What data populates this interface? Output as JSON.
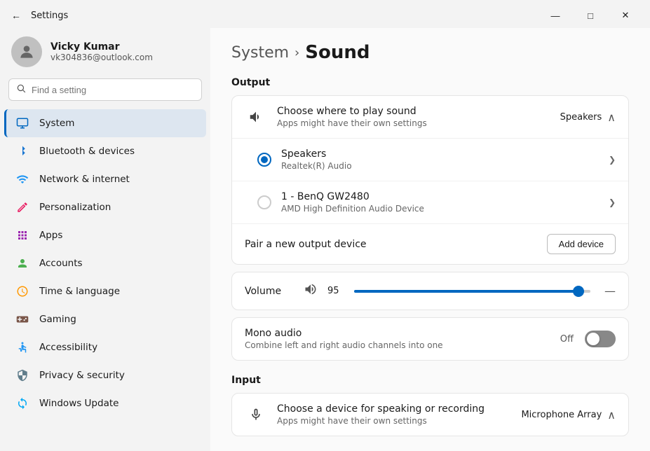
{
  "titlebar": {
    "back_icon": "←",
    "title": "Settings",
    "minimize": "—",
    "maximize": "□",
    "close": "✕"
  },
  "sidebar": {
    "user": {
      "name": "Vicky Kumar",
      "email": "vk304836@outlook.com"
    },
    "search_placeholder": "Find a setting",
    "nav_items": [
      {
        "id": "system",
        "label": "System",
        "icon": "💻",
        "active": true
      },
      {
        "id": "bluetooth",
        "label": "Bluetooth & devices",
        "icon": "🔵",
        "active": false
      },
      {
        "id": "network",
        "label": "Network & internet",
        "icon": "🌐",
        "active": false
      },
      {
        "id": "personalization",
        "label": "Personalization",
        "icon": "✏️",
        "active": false
      },
      {
        "id": "apps",
        "label": "Apps",
        "icon": "📦",
        "active": false
      },
      {
        "id": "accounts",
        "label": "Accounts",
        "icon": "👤",
        "active": false
      },
      {
        "id": "time",
        "label": "Time & language",
        "icon": "🌍",
        "active": false
      },
      {
        "id": "gaming",
        "label": "Gaming",
        "icon": "🎮",
        "active": false
      },
      {
        "id": "accessibility",
        "label": "Accessibility",
        "icon": "♿",
        "active": false
      },
      {
        "id": "privacy",
        "label": "Privacy & security",
        "icon": "🛡️",
        "active": false
      },
      {
        "id": "update",
        "label": "Windows Update",
        "icon": "🔄",
        "active": false
      }
    ]
  },
  "content": {
    "breadcrumb_parent": "System",
    "breadcrumb_separator": "›",
    "breadcrumb_current": "Sound",
    "output_section_label": "Output",
    "choose_where": {
      "title": "Choose where to play sound",
      "subtitle": "Apps might have their own settings",
      "current_value": "Speakers",
      "icon": "🔊"
    },
    "output_devices": [
      {
        "id": "speakers",
        "name": "Speakers",
        "detail": "Realtek(R) Audio",
        "selected": true
      },
      {
        "id": "benq",
        "name": "1 - BenQ GW2480",
        "detail": "AMD High Definition Audio Device",
        "selected": false
      }
    ],
    "pair_new_output": "Pair a new output device",
    "add_device_btn": "Add device",
    "volume": {
      "label": "Volume",
      "value": 95,
      "icon": "🔊"
    },
    "mono_audio": {
      "title": "Mono audio",
      "subtitle": "Combine left and right audio channels into one",
      "state": "Off",
      "enabled": false
    },
    "input_section_label": "Input",
    "choose_input": {
      "title": "Choose a device for speaking or recording",
      "subtitle": "Apps might have their own settings",
      "current_value": "Microphone Array",
      "icon": "🎤"
    }
  }
}
